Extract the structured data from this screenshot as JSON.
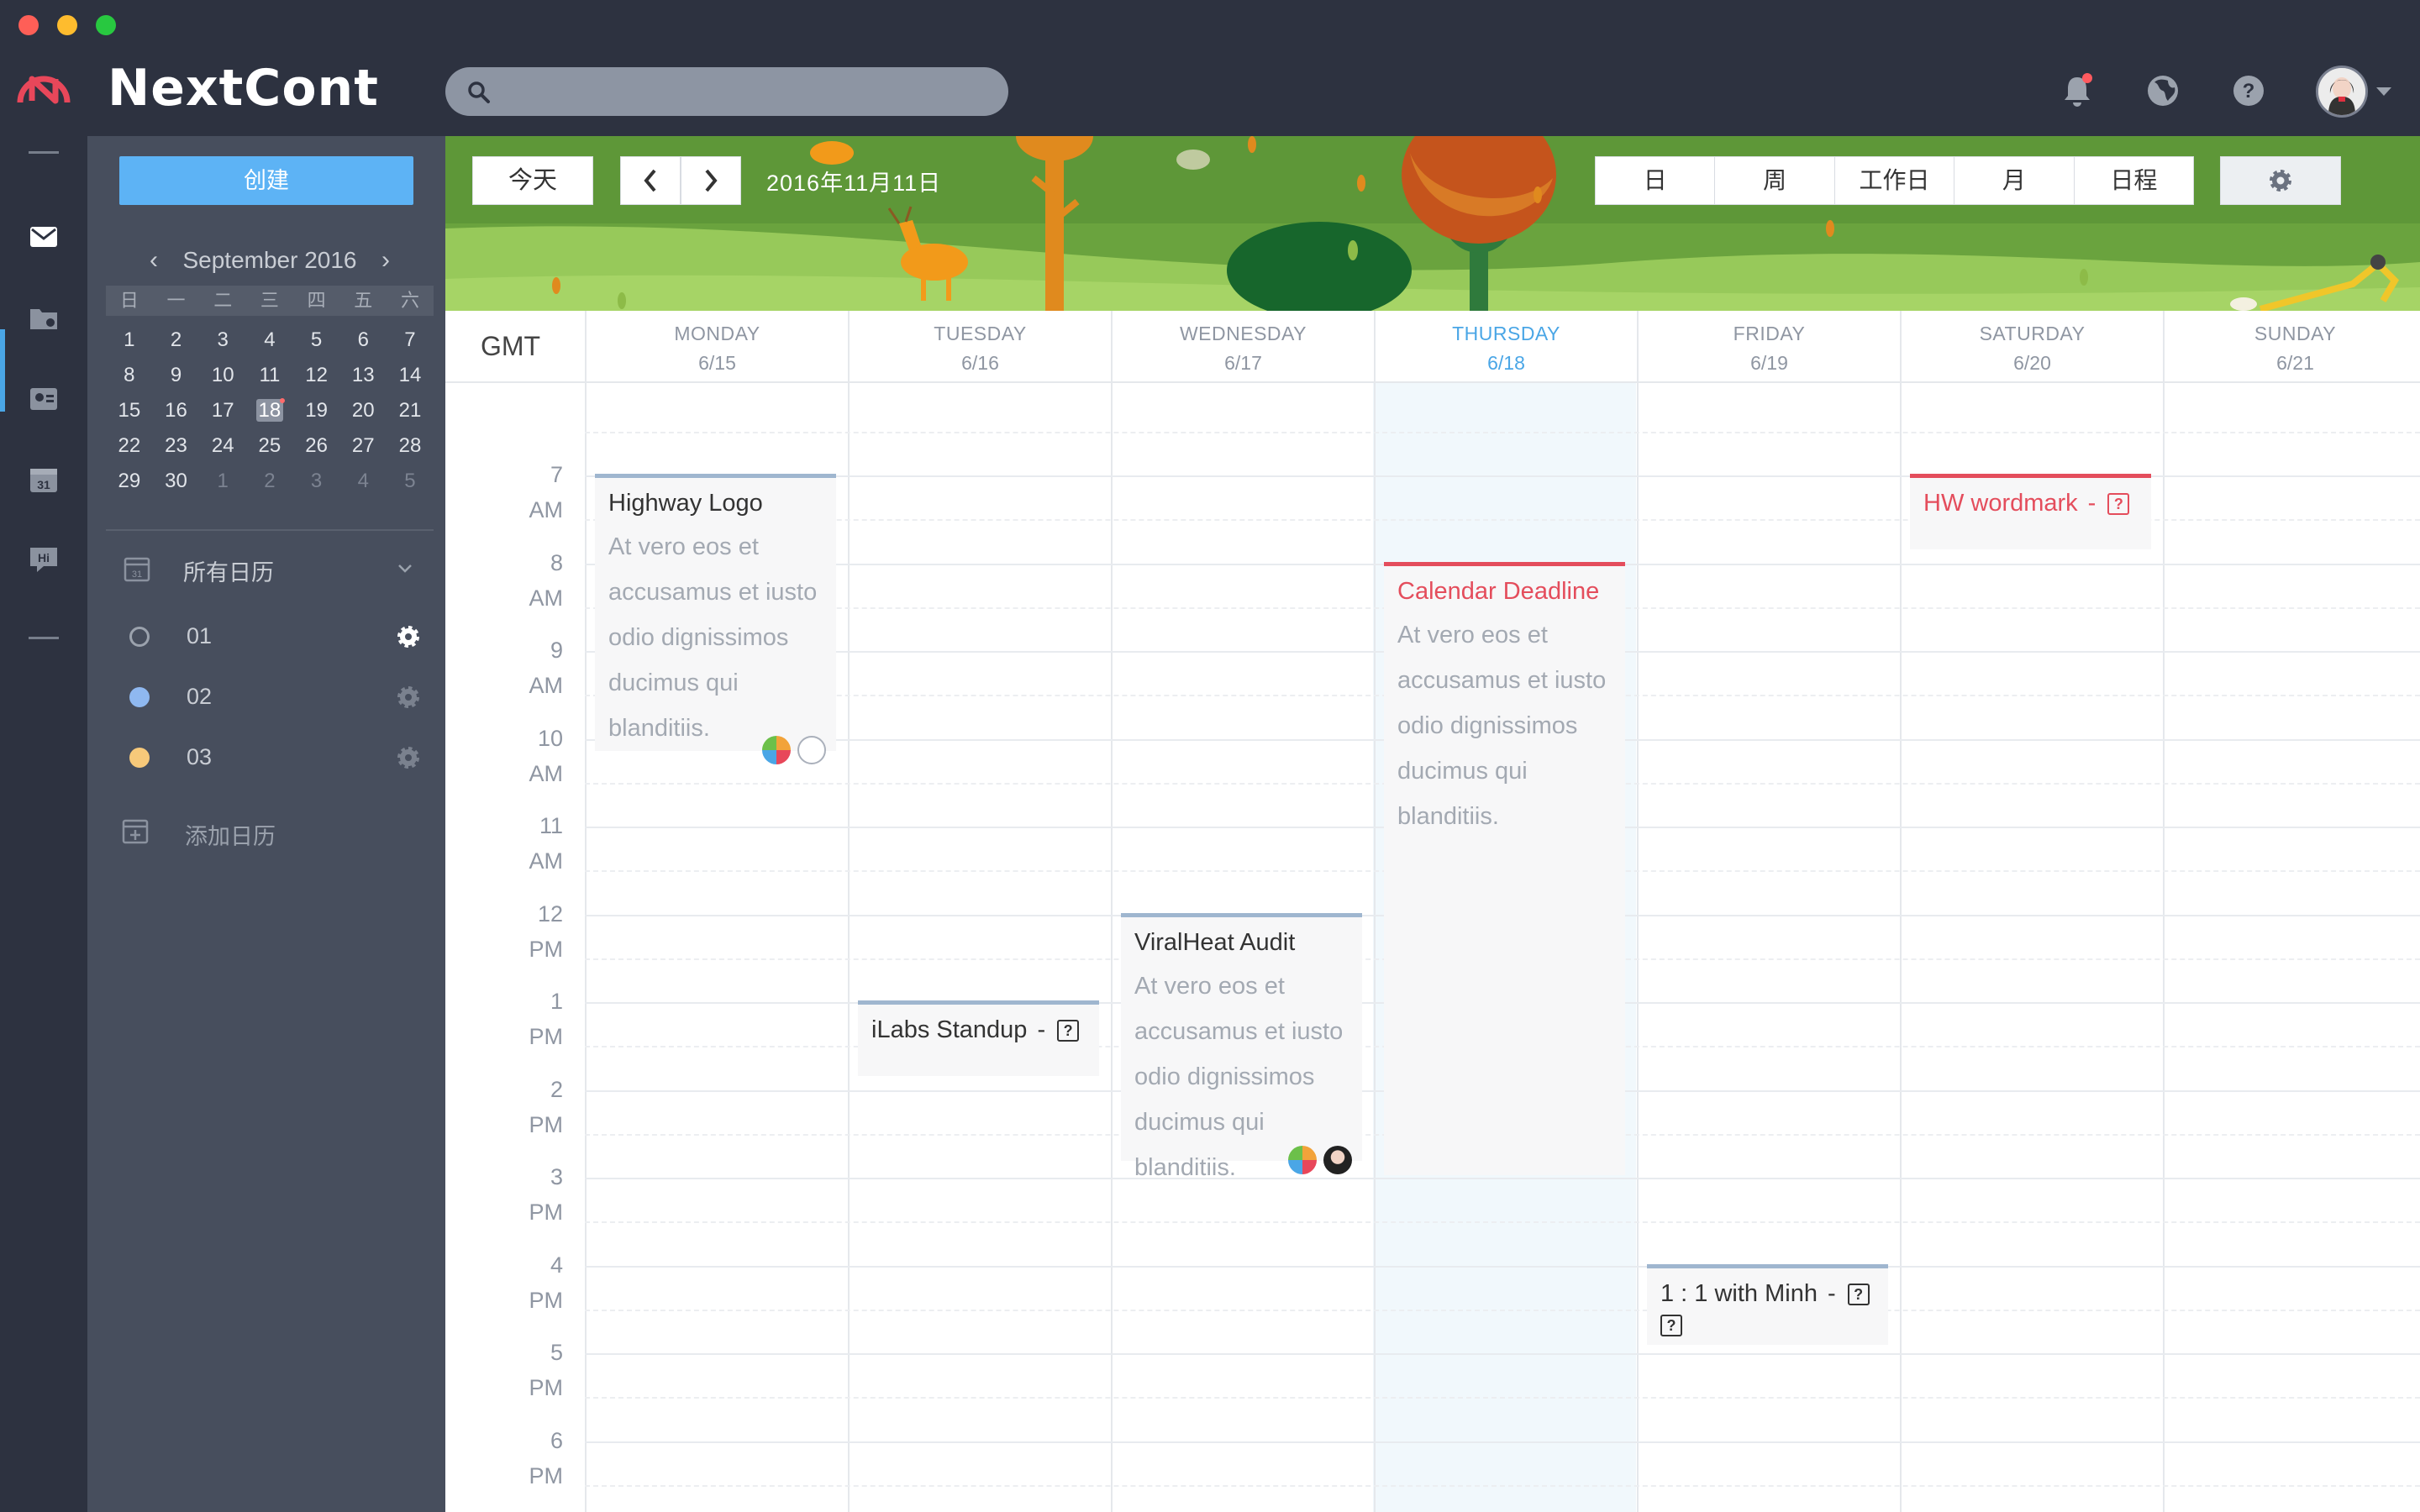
{
  "app": {
    "name": "NextCont"
  },
  "colors": {
    "accent": "#4aa6e6",
    "create": "#5db3f5",
    "event_red": "#e44d5c",
    "event_blue": "#9fb6cf",
    "sidebar": "#474e5d",
    "topbar": "#2d3240"
  },
  "search": {
    "placeholder": ""
  },
  "topbar": {
    "icons": [
      "bell-icon",
      "globe-icon",
      "help-icon"
    ]
  },
  "sidebar": {
    "create_label": "创建",
    "mini_calendar": {
      "month_label": "September 2016",
      "weekdays": [
        "日",
        "一",
        "二",
        "三",
        "四",
        "五",
        "六"
      ],
      "weeks": [
        [
          "1",
          "2",
          "3",
          "4",
          "5",
          "6",
          "7"
        ],
        [
          "8",
          "9",
          "10",
          "11",
          "12",
          "13",
          "14"
        ],
        [
          "15",
          "16",
          "17",
          "18",
          "19",
          "20",
          "21"
        ],
        [
          "22",
          "23",
          "24",
          "25",
          "26",
          "27",
          "28"
        ],
        [
          "29",
          "30",
          "1",
          "2",
          "3",
          "4",
          "5"
        ]
      ],
      "today": "18"
    },
    "all_calendars_label": "所有日历",
    "calendars": [
      {
        "name": "01",
        "color": "none"
      },
      {
        "name": "02",
        "color": "#8fb8f0"
      },
      {
        "name": "03",
        "color": "#f7c97a"
      }
    ],
    "add_calendar_label": "添加日历"
  },
  "toolbar": {
    "today_label": "今天",
    "current_date": "2016年11月11日",
    "views": [
      "日",
      "周",
      "工作日",
      "月",
      "日程"
    ]
  },
  "week": {
    "timezone_label": "GMT",
    "days": [
      {
        "name": "MONDAY",
        "date": "6/15"
      },
      {
        "name": "TUESDAY",
        "date": "6/16"
      },
      {
        "name": "WEDNESDAY",
        "date": "6/17"
      },
      {
        "name": "THURSDAY",
        "date": "6/18",
        "today": true
      },
      {
        "name": "FRIDAY",
        "date": "6/19"
      },
      {
        "name": "SATURDAY",
        "date": "6/20"
      },
      {
        "name": "SUNDAY",
        "date": "6/21"
      }
    ],
    "hours": [
      {
        "h": "7",
        "p": "AM"
      },
      {
        "h": "8",
        "p": "AM"
      },
      {
        "h": "9",
        "p": "AM"
      },
      {
        "h": "10",
        "p": "AM"
      },
      {
        "h": "11",
        "p": "AM"
      },
      {
        "h": "12",
        "p": "PM"
      },
      {
        "h": "1",
        "p": "PM"
      },
      {
        "h": "2",
        "p": "PM"
      },
      {
        "h": "3",
        "p": "PM"
      },
      {
        "h": "4",
        "p": "PM"
      },
      {
        "h": "5",
        "p": "PM"
      },
      {
        "h": "6",
        "p": "PM"
      }
    ]
  },
  "events": [
    {
      "id": "highway",
      "title": "Highway Logo",
      "description": "At vero eos et accusamus et iusto odio dignissimos ducimus qui blanditiis.",
      "day": "MONDAY",
      "style": "blue",
      "attendees": 2
    },
    {
      "id": "ilabs",
      "title": "iLabs Standup",
      "suffix": "-",
      "day": "TUESDAY",
      "style": "blue",
      "has_unknown": true
    },
    {
      "id": "viralheat",
      "title": "ViralHeat Audit",
      "description": "At vero eos et accusamus et iusto odio dignissimos ducimus qui blanditiis.",
      "day": "WEDNESDAY",
      "style": "blue",
      "attendees": 2
    },
    {
      "id": "calendar-deadline",
      "title": "Calendar Deadline",
      "description": "At vero eos et accusamus et iusto odio dignissimos ducimus qui blanditiis.",
      "day": "THURSDAY",
      "style": "red"
    },
    {
      "id": "one-on-one",
      "title": "1 : 1 with Minh",
      "suffix": "-",
      "day": "FRIDAY",
      "style": "blue",
      "has_unknown": true
    },
    {
      "id": "hw-wordmark",
      "title": "HW wordmark",
      "suffix": "-",
      "day": "SATURDAY",
      "style": "red",
      "has_unknown": true
    }
  ],
  "unknown_glyph": "?"
}
